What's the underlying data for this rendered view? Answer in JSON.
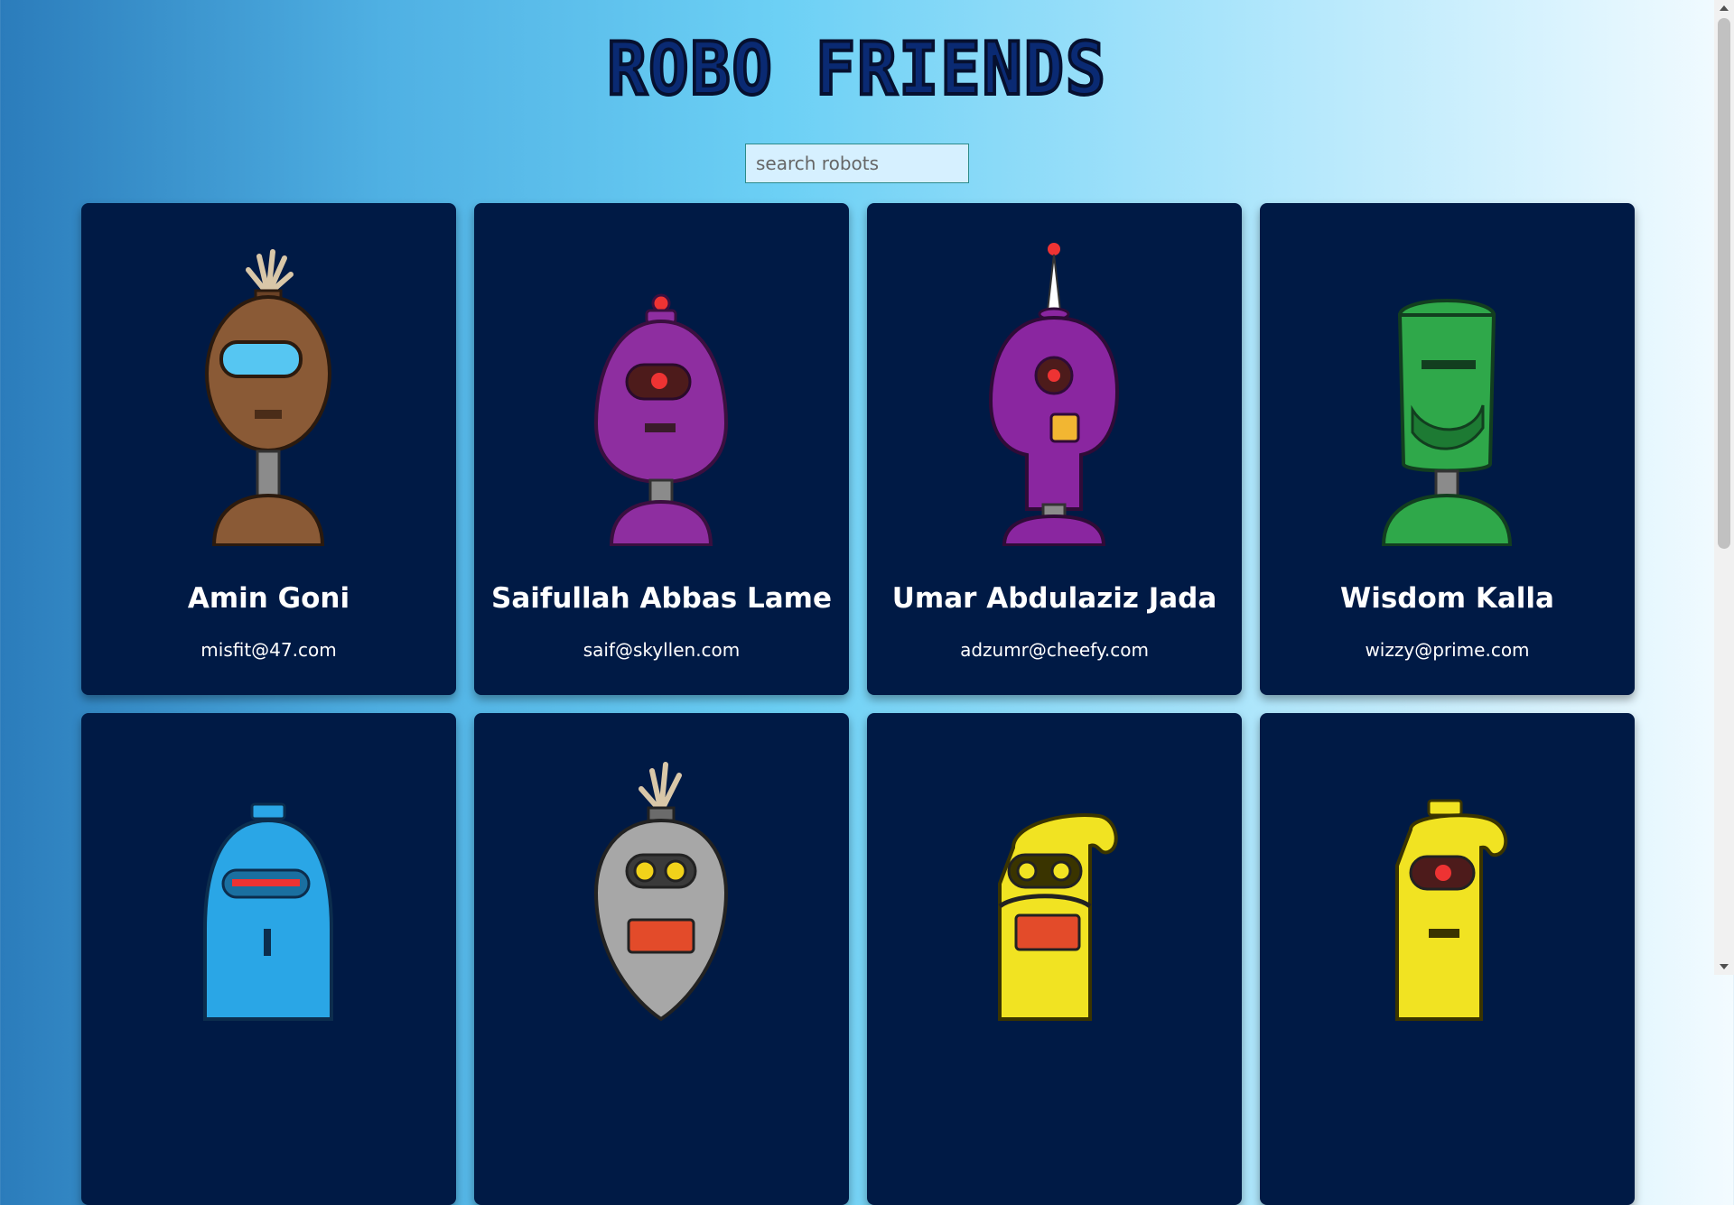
{
  "header": {
    "title": "ROBO FRIENDS"
  },
  "search": {
    "placeholder": "search robots",
    "value": ""
  },
  "robots": [
    {
      "name": "Amin Goni",
      "email": "misfit@47.com",
      "color": "#8a5a36"
    },
    {
      "name": "Saifullah Abbas Lame",
      "email": "saif@skyllen.com",
      "color": "#8e2ea0"
    },
    {
      "name": "Umar Abdulaziz Jada",
      "email": "adzumr@cheefy.com",
      "color": "#8a26a0"
    },
    {
      "name": "Wisdom Kalla",
      "email": "wizzy@prime.com",
      "color": "#2fa84a"
    },
    {
      "name": "",
      "email": "",
      "color": "#2aa6e6"
    },
    {
      "name": "",
      "email": "",
      "color": "#a7a7a7"
    },
    {
      "name": "",
      "email": "",
      "color": "#f1e322"
    },
    {
      "name": "",
      "email": "",
      "color": "#f1e322"
    }
  ],
  "colors": {
    "card_bg": "#001a45",
    "title": "#0a2a73"
  }
}
